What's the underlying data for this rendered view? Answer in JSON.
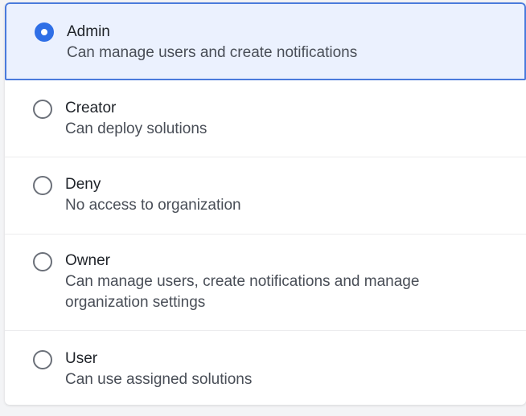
{
  "roles": [
    {
      "label": "Admin",
      "description": "Can manage users and create notifications",
      "selected": true
    },
    {
      "label": "Creator",
      "description": "Can deploy solutions",
      "selected": false
    },
    {
      "label": "Deny",
      "description": "No access to organization",
      "selected": false
    },
    {
      "label": "Owner",
      "description": "Can manage users, create notifications and manage organization settings",
      "selected": false
    },
    {
      "label": "User",
      "description": "Can use assigned solutions",
      "selected": false
    }
  ],
  "colors": {
    "accent": "#2f6fe6",
    "selected_background": "#ebf1fe",
    "selected_border": "#4a7bdc"
  },
  "icons": {
    "selected": "radio-checked-icon",
    "unselected": "radio-unchecked-icon"
  }
}
